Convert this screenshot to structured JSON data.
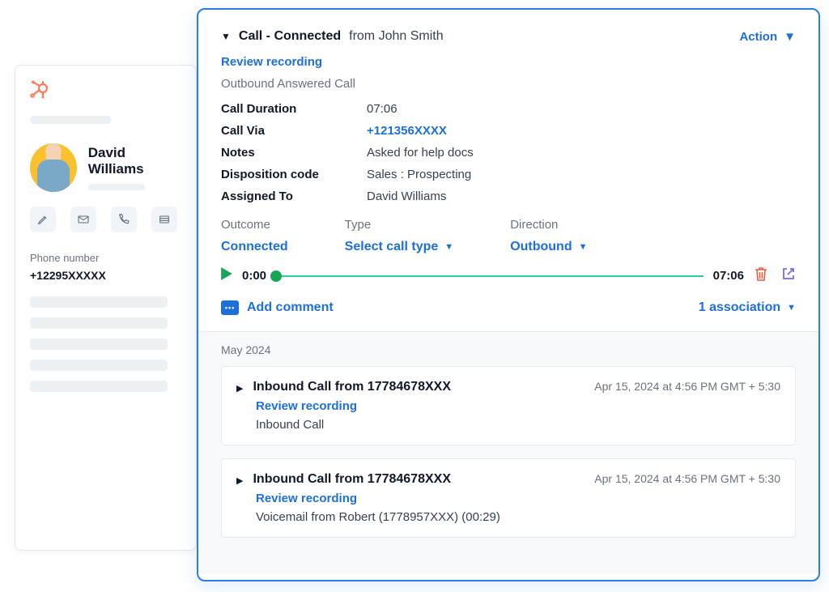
{
  "contact": {
    "name": "David Williams",
    "phone_label": "Phone number",
    "phone_value": "+12295XXXXX"
  },
  "call": {
    "title_prefix": "Call - Connected",
    "from_text": "from John Smith",
    "action_label": "Action",
    "review_link": "Review recording",
    "subtype": "Outbound Answered Call",
    "details": {
      "duration_label": "Call Duration",
      "duration_value": "07:06",
      "via_label": "Call Via",
      "via_value": "+121356XXXX",
      "notes_label": "Notes",
      "notes_value": "Asked for help docs",
      "disposition_label": "Disposition code",
      "disposition_value": "Sales : Prospecting",
      "assigned_label": "Assigned To",
      "assigned_value": "David Williams"
    },
    "selectors": {
      "outcome_label": "Outcome",
      "outcome_value": "Connected",
      "type_label": "Type",
      "type_value": "Select call type",
      "direction_label": "Direction",
      "direction_value": "Outbound"
    },
    "player": {
      "current_time": "0:00",
      "total_time": "07:06"
    },
    "add_comment_label": "Add comment",
    "association_label": "1 association"
  },
  "history": {
    "month_label": "May 2024",
    "items": [
      {
        "title": "Inbound Call from 17784678XXX",
        "review_link": "Review recording",
        "subtype": "Inbound Call",
        "timestamp": "Apr 15, 2024 at 4:56 PM GMT + 5:30"
      },
      {
        "title": "Inbound Call from 17784678XXX",
        "review_link": "Review recording",
        "subtype": "Voicemail from Robert (1778957XXX) (00:29)",
        "timestamp": "Apr 15, 2024 at 4:56 PM GMT + 5:30"
      }
    ]
  }
}
